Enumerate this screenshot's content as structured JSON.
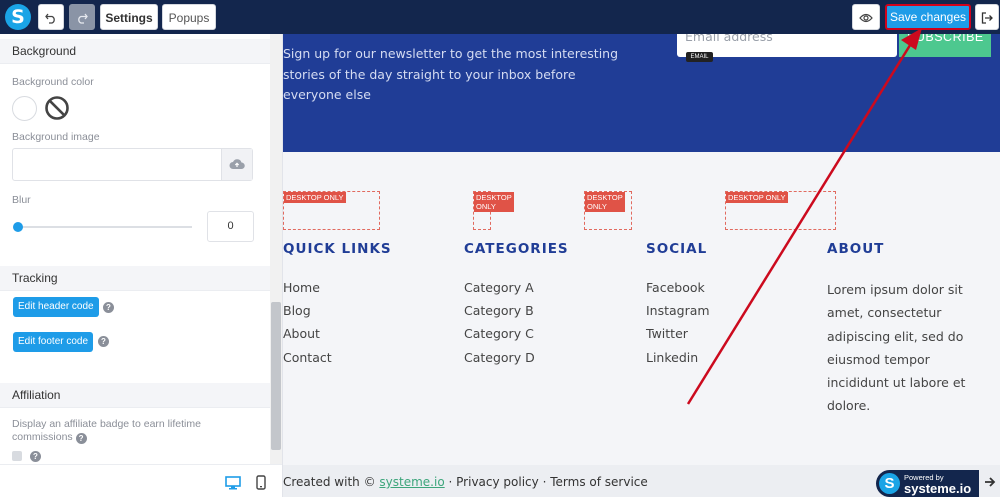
{
  "toolbar": {
    "logo": "S",
    "settings_label": "Settings",
    "popups_label": "Popups",
    "save_label": "Save changes"
  },
  "panel": {
    "background": {
      "title": "Background",
      "color_label": "Background color",
      "image_label": "Background image",
      "blur_label": "Blur",
      "blur_value": "0"
    },
    "tracking": {
      "title": "Tracking",
      "header_button": "Edit header code",
      "footer_button": "Edit footer code"
    },
    "affiliation": {
      "title": "Affiliation",
      "description": "Display an affiliate badge to earn lifetime commissions"
    }
  },
  "page": {
    "newsletter": {
      "text": "Sign up for our newsletter to get the most interesting stories of the day straight to your inbox before everyone else",
      "email_placeholder": "Email address",
      "email_tag": "EMAIL",
      "subscribe_label": "SUBSCRIBE"
    },
    "desktop_only_label": "DESKTOP ONLY",
    "desktop_only_line1": "DESKTOP",
    "desktop_only_line2": "ONLY",
    "columns": [
      {
        "title": "QUICK LINKS",
        "links": [
          "Home",
          "Blog",
          "About",
          "Contact"
        ]
      },
      {
        "title": "CATEGORIES",
        "links": [
          "Category A",
          "Category B",
          "Category C",
          "Category D"
        ]
      },
      {
        "title": "SOCIAL",
        "links": [
          "Facebook",
          "Instagram",
          "Twitter",
          "Linkedin"
        ]
      },
      {
        "title": "ABOUT",
        "text": "Lorem ipsum dolor sit amet, consectetur adipiscing elit, sed do eiusmod tempor incididunt ut labore et dolore."
      }
    ],
    "footer": {
      "created_with": "Created with ©",
      "brand_link": "systeme.io",
      "sep": "·",
      "privacy": "Privacy policy",
      "terms": "Terms of service"
    },
    "powered": {
      "small": "Powered by",
      "brand": "systeme.io"
    }
  },
  "colors": {
    "topbar": "#13264d",
    "accent": "#1e9ce8",
    "newsletter_bg": "#203d96",
    "subscribe": "#4dc88f",
    "annotation": "#d0021b"
  }
}
